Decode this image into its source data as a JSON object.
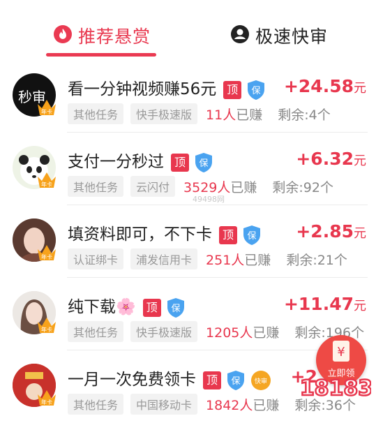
{
  "tabs": [
    {
      "label": "推荐悬赏",
      "icon": "flame-icon",
      "active": true
    },
    {
      "label": "极速快审",
      "icon": "user-circle-icon",
      "active": false
    }
  ],
  "colors": {
    "accent": "#e8374e",
    "tag_bg": "#f2f2f2"
  },
  "tasks": [
    {
      "title": "看一分钟视频赚56元",
      "top_badge": "顶",
      "reward_amount": "+24.58",
      "reward_unit": "元",
      "tags": [
        "其他任务",
        "快手极速版"
      ],
      "earned": "11人",
      "earned_suffix": "已赚",
      "remaining": "剩余:4个",
      "avatar_text": "秒审",
      "crown_text": "年卡"
    },
    {
      "title": "支付一分秒过",
      "top_badge": "顶",
      "reward_amount": "+6.32",
      "reward_unit": "元",
      "tags": [
        "其他任务",
        "云闪付"
      ],
      "earned": "3529人",
      "earned_suffix": "已赚",
      "remaining": "剩余:92个",
      "crown_text": "年卡"
    },
    {
      "title": "填资料即可，不下卡",
      "top_badge": "顶",
      "reward_amount": "+2.85",
      "reward_unit": "元",
      "tags": [
        "认证绑卡",
        "浦发信用卡"
      ],
      "earned": "251人",
      "earned_suffix": "已赚",
      "remaining": "剩余:21个",
      "crown_text": "年卡"
    },
    {
      "title": "纯下载🌸",
      "top_badge": "顶",
      "reward_amount": "+11.47",
      "reward_unit": "元",
      "tags": [
        "其他任务",
        "快手极速版"
      ],
      "earned": "1205人",
      "earned_suffix": "已赚",
      "remaining": "剩余:196个",
      "crown_text": "年卡"
    },
    {
      "title": "一月一次免费领卡",
      "top_badge": "顶",
      "extra_badge": "快审",
      "reward_amount": "+2",
      "reward_unit": "",
      "tags": [
        "其他任务",
        "中国移动卡"
      ],
      "earned": "1842人",
      "earned_suffix": "已赚",
      "remaining": "剩余:36个",
      "crown_text": "年卡"
    }
  ],
  "watermark": "49498网",
  "fab": {
    "icon": "yen-icon",
    "label": "立即领"
  },
  "site_logo": "18183"
}
